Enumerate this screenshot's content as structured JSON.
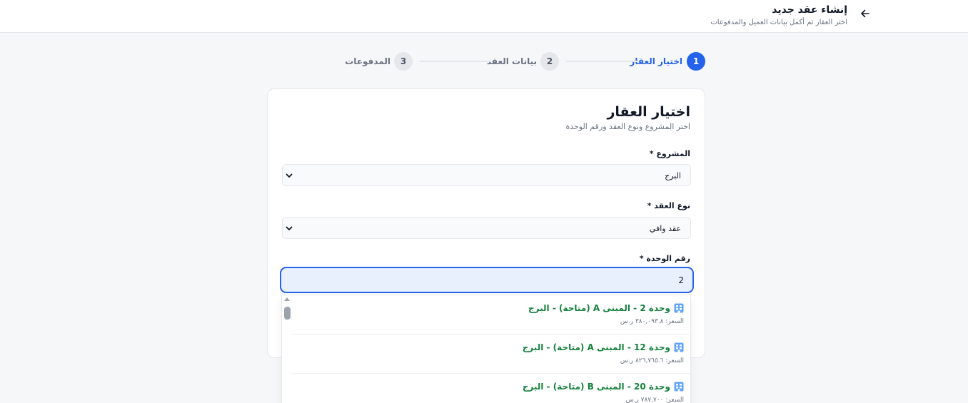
{
  "header": {
    "title": "إنشاء عقد جديد",
    "subtitle": "اختر العقار ثم أكمل بيانات العميل والمدفوعات",
    "back_icon": "arrow-right-icon"
  },
  "stepper": {
    "steps": [
      {
        "number": "1",
        "label": "اختيار العقار",
        "state": "active"
      },
      {
        "number": "2",
        "label": "بيانات العقد",
        "state": "inactive"
      },
      {
        "number": "3",
        "label": "المدفوعات",
        "state": "inactive"
      }
    ]
  },
  "card": {
    "title": "اختيار العقار",
    "subtitle": "اختر المشروع ونوع العقد ورقم الوحدة",
    "project": {
      "label": "المشروع *",
      "value": "البرج"
    },
    "contract_type": {
      "label": "نوع العقد *",
      "value": "عقد وافي"
    },
    "unit_number": {
      "label": "رقم الوحدة *",
      "value": "2"
    }
  },
  "dropdown": {
    "options": [
      {
        "title": "وحدة 2 - المبنى A (متاحة) - البرج",
        "price": "السعر: ٣٨٠,٠٩٣.٨ ر.س",
        "icon": "building-icon"
      },
      {
        "title": "وحدة 12 - المبنى A (متاحة) - البرج",
        "price": "السعر: ٨٢٦,٧٦٥.٦ ر.س",
        "icon": "building-icon"
      },
      {
        "title": "وحدة 20 - المبنى B (متاحة) - البرج",
        "price": "السعر: ٧٨٧,٧٠٠ ر.س",
        "icon": "building-icon"
      }
    ]
  },
  "colors": {
    "accent": "#2563eb",
    "available_text": "#15803d",
    "input_focus_bg": "#e8f0fe"
  }
}
